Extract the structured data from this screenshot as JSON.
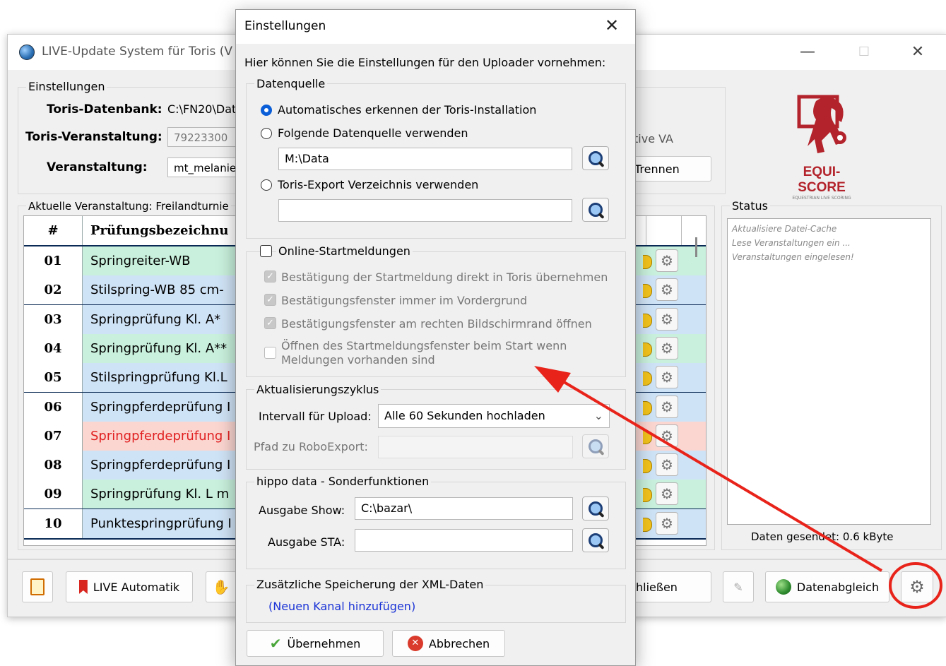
{
  "main_window": {
    "title": "LIVE-Update System für Toris (V",
    "controls": {
      "minimize": "—",
      "maximize": "☐",
      "close": "✕"
    },
    "settings_group": {
      "label": "Einstellungen",
      "toris_db_label": "Toris-Datenbank:",
      "toris_db_value": "C:\\FN20\\Dat",
      "veranstaltung_toris_label": "Toris-Veranstaltung:",
      "veranstaltung_toris_value": "79223300",
      "veranstaltung_label": "Veranstaltung:",
      "veranstaltung_value": "mt_melanie",
      "active_va_text": "tive VA",
      "trennen_label": "Trennen"
    },
    "logo": {
      "brand": "EQUI-SCORE",
      "tagline": "EQUESTRIAN LIVE SCORING"
    },
    "current_event_label": "Aktuelle Veranstaltung: Freilandturnie",
    "table": {
      "headers": [
        "#",
        "Prüfungsbezeichnu"
      ],
      "rows": [
        {
          "num": "01",
          "name": "Springreiter-WB",
          "color": "#c8f0dc",
          "text_color": "#000000"
        },
        {
          "num": "02",
          "name": "Stilspring-WB 85 cm-",
          "color": "#cfe3f6",
          "text_color": "#000000"
        },
        {
          "num": "03",
          "name": "Springprüfung Kl. A*",
          "color": "#cfe3f6",
          "text_color": "#000000"
        },
        {
          "num": "04",
          "name": "Springprüfung Kl. A**",
          "color": "#c8f0dc",
          "text_color": "#000000"
        },
        {
          "num": "05",
          "name": "Stilspringprüfung Kl.L",
          "color": "#cfe3f6",
          "text_color": "#000000"
        },
        {
          "num": "06",
          "name": "Springpferdeprüfung I",
          "color": "#cfe3f6",
          "text_color": "#000000"
        },
        {
          "num": "07",
          "name": "Springpferdeprüfung I",
          "color": "#fbd5d0",
          "text_color": "#e02020"
        },
        {
          "num": "08",
          "name": "Springpferdeprüfung I",
          "color": "#cfe3f6",
          "text_color": "#000000"
        },
        {
          "num": "09",
          "name": "Springprüfung Kl. L m",
          "color": "#c8f0dc",
          "text_color": "#000000"
        },
        {
          "num": "10",
          "name": "Punktespringprüfung I",
          "color": "#cfe3f6",
          "text_color": "#000000"
        }
      ]
    },
    "status": {
      "label": "Status",
      "lines": [
        "Aktualisiere Datei-Cache",
        "Lese Veranstaltungen ein ...",
        "Veranstaltungen eingelesen!"
      ],
      "sent": "Daten gesendet: 0.6 kByte"
    },
    "bottom": {
      "live_automatik": "LIVE Automatik",
      "schliessen_partial": "hließen",
      "datenabgleich": "Datenabgleich"
    }
  },
  "dialog": {
    "title": "Einstellungen",
    "intro": "Hier können Sie die Einstellungen für den Uploader vornehmen:",
    "datenquelle": {
      "label": "Datenquelle",
      "opt_auto": "Automatisches erkennen der Toris-Installation",
      "opt_folgende": "Folgende Datenquelle verwenden",
      "path_value": "M:\\Data",
      "opt_export": "Toris-Export Verzeichnis verwenden",
      "export_value": ""
    },
    "online": {
      "label": "Online-Startmeldungen",
      "opt1": "Bestätigung der Startmeldung direkt in Toris übernehmen",
      "opt2": "Bestätigungsfenster immer im Vordergrund",
      "opt3": "Bestätigungsfenster am rechten Bildschirmrand öffnen",
      "opt4_line1": "Öffnen des Startmeldungsfenster beim Start wenn",
      "opt4_line2": "Meldungen vorhanden sind"
    },
    "zyklus": {
      "label": "Aktualisierungszyklus",
      "interval_label": "Intervall für Upload:",
      "interval_value": "Alle 60 Sekunden hochladen",
      "robo_label": "Pfad zu RoboExport:",
      "robo_value": ""
    },
    "hippo": {
      "label": "hippo data - Sonderfunktionen",
      "show_label": "Ausgabe Show:",
      "show_value": "C:\\bazar\\",
      "sta_label": "Ausgabe STA:",
      "sta_value": ""
    },
    "xml": {
      "label": "Zusätzliche Speicherung der XML-Daten",
      "link": "(Neuen Kanal hinzufügen)"
    },
    "buttons": {
      "apply": "Übernehmen",
      "cancel": "Abbrechen"
    }
  },
  "annotation_color": "#e8231a"
}
